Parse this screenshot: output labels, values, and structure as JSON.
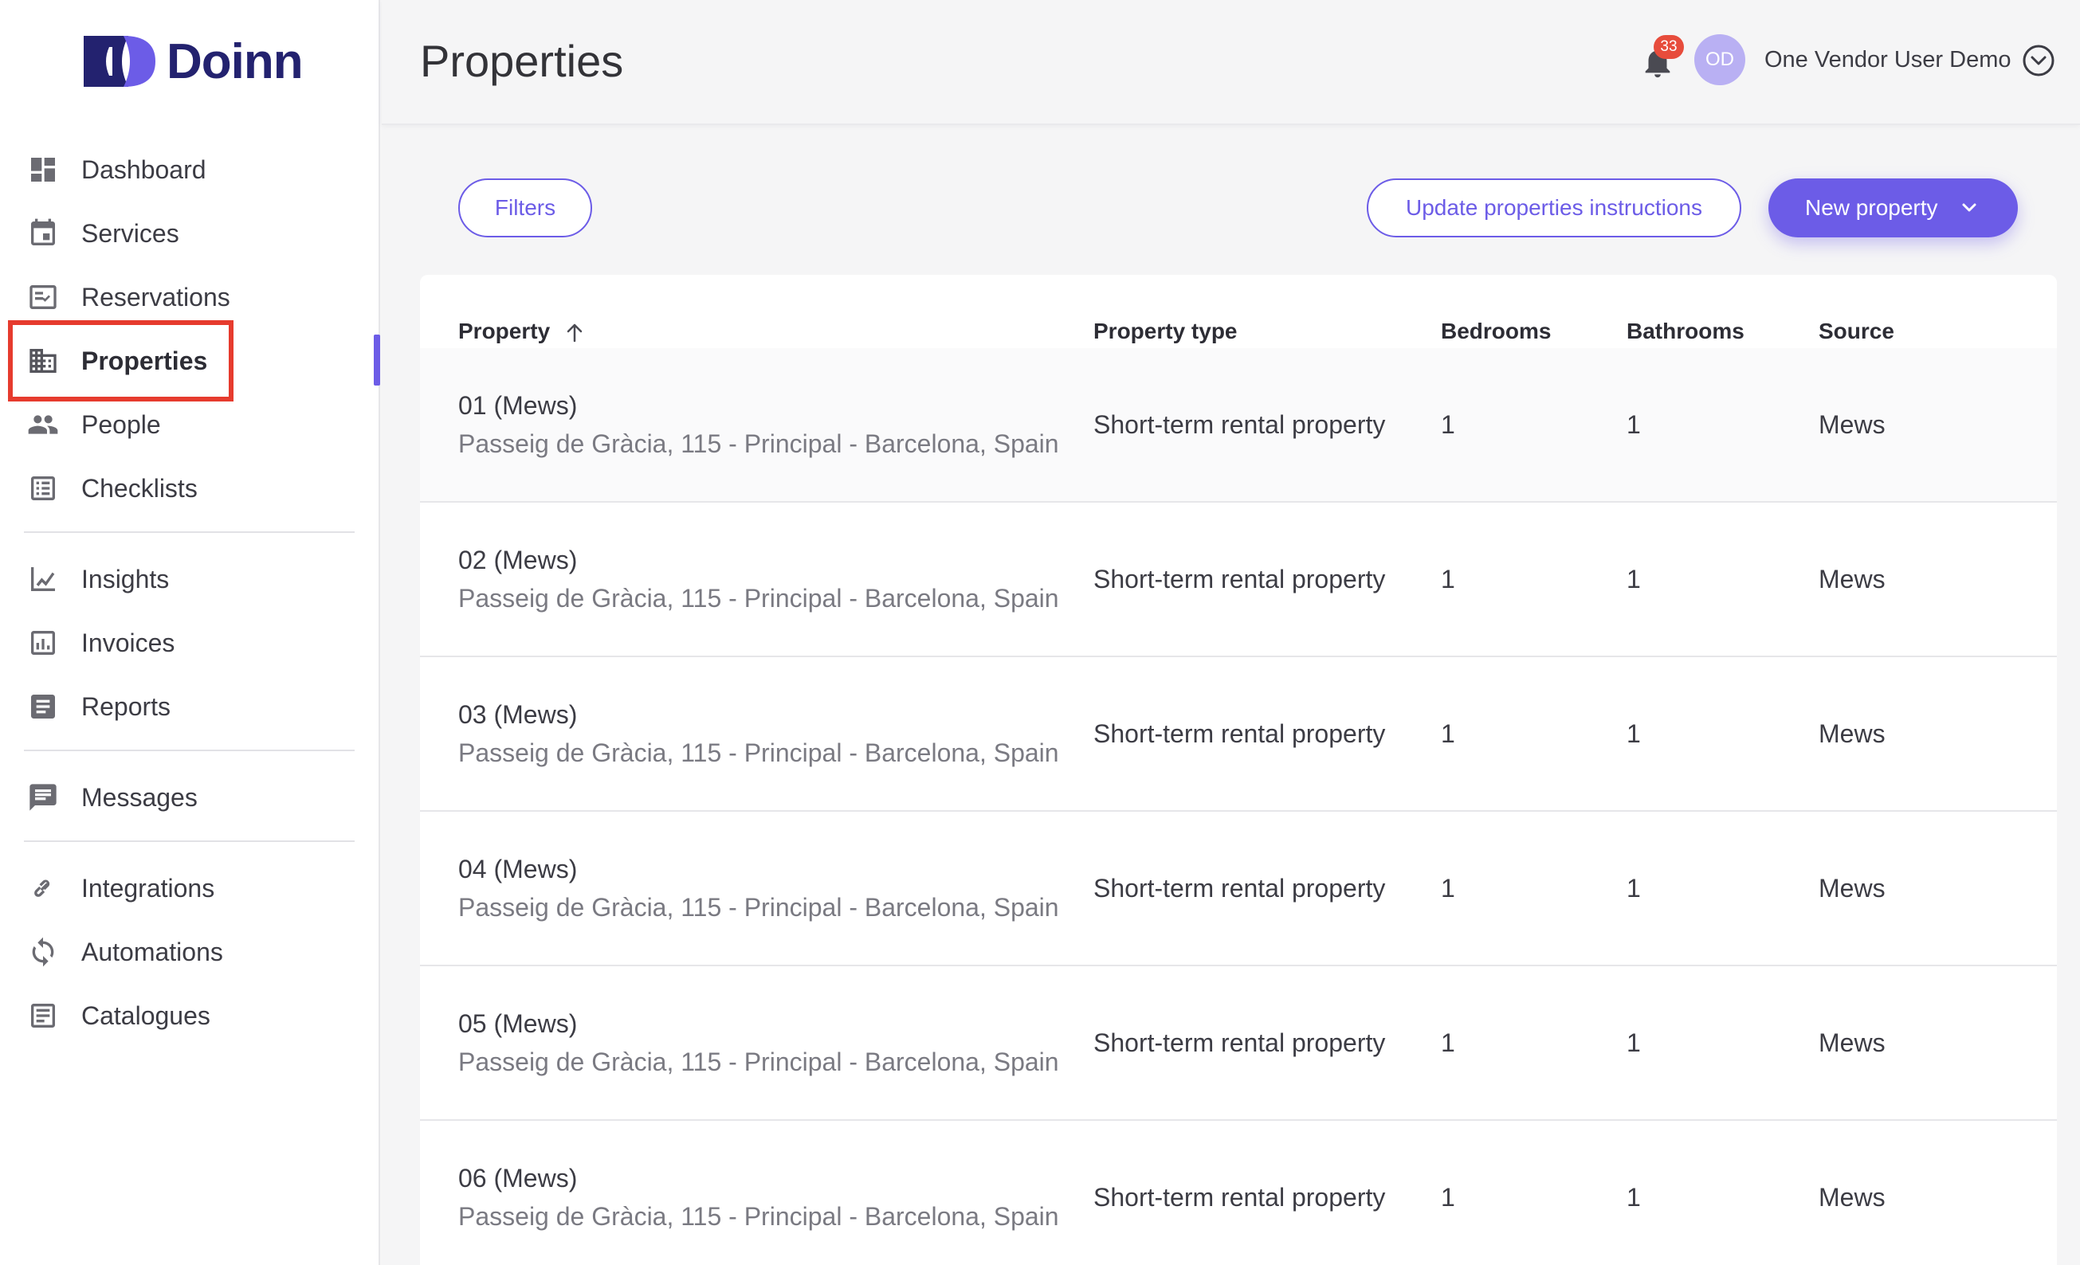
{
  "app": {
    "name": "Doinn"
  },
  "sidebar": {
    "items": [
      {
        "label": "Dashboard",
        "icon": "dashboard-icon"
      },
      {
        "label": "Services",
        "icon": "calendar-icon"
      },
      {
        "label": "Reservations",
        "icon": "checklist-icon"
      },
      {
        "label": "Properties",
        "icon": "building-icon"
      },
      {
        "label": "People",
        "icon": "people-icon"
      },
      {
        "label": "Checklists",
        "icon": "list-icon"
      },
      {
        "label": "Insights",
        "icon": "chart-line-icon"
      },
      {
        "label": "Invoices",
        "icon": "invoice-icon"
      },
      {
        "label": "Reports",
        "icon": "report-icon"
      },
      {
        "label": "Messages",
        "icon": "message-icon"
      },
      {
        "label": "Integrations",
        "icon": "link-icon"
      },
      {
        "label": "Automations",
        "icon": "sync-icon"
      },
      {
        "label": "Catalogues",
        "icon": "catalogue-icon"
      }
    ],
    "active": "Properties"
  },
  "header": {
    "title": "Properties",
    "notifications_count": "33",
    "avatar_initials": "OD",
    "user_name": "One Vendor User Demo"
  },
  "toolbar": {
    "filters_label": "Filters",
    "update_label": "Update properties instructions",
    "new_label": "New property"
  },
  "table": {
    "columns": [
      "Property",
      "Property type",
      "Bedrooms",
      "Bathrooms",
      "Source"
    ],
    "rows": [
      {
        "name": "01 (Mews)",
        "address": "Passeig de Gràcia, 115 - Principal - Barcelona, Spain",
        "type": "Short-term rental property",
        "bedrooms": "1",
        "bathrooms": "1",
        "source": "Mews"
      },
      {
        "name": "02 (Mews)",
        "address": "Passeig de Gràcia, 115 - Principal - Barcelona, Spain",
        "type": "Short-term rental property",
        "bedrooms": "1",
        "bathrooms": "1",
        "source": "Mews"
      },
      {
        "name": "03 (Mews)",
        "address": "Passeig de Gràcia, 115 - Principal - Barcelona, Spain",
        "type": "Short-term rental property",
        "bedrooms": "1",
        "bathrooms": "1",
        "source": "Mews"
      },
      {
        "name": "04 (Mews)",
        "address": "Passeig de Gràcia, 115 - Principal - Barcelona, Spain",
        "type": "Short-term rental property",
        "bedrooms": "1",
        "bathrooms": "1",
        "source": "Mews"
      },
      {
        "name": "05 (Mews)",
        "address": "Passeig de Gràcia, 115 - Principal - Barcelona, Spain",
        "type": "Short-term rental property",
        "bedrooms": "1",
        "bathrooms": "1",
        "source": "Mews"
      },
      {
        "name": "06 (Mews)",
        "address": "Passeig de Gràcia, 115 - Principal - Barcelona, Spain",
        "type": "Short-term rental property",
        "bedrooms": "1",
        "bathrooms": "1",
        "source": "Mews"
      }
    ]
  },
  "colors": {
    "accent": "#6c5ce7",
    "brand": "#23226f",
    "badge": "#e74c3c",
    "highlight": "#e63b2e"
  }
}
